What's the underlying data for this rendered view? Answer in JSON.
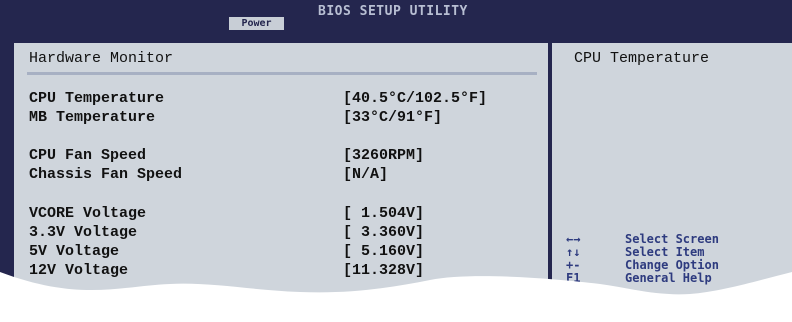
{
  "header": {
    "title": "BIOS SETUP UTILITY",
    "active_tab": "Power"
  },
  "panel": {
    "title": "Hardware Monitor",
    "rows": [
      {
        "label": "CPU Temperature",
        "value": "[40.5°C/102.5°F]"
      },
      {
        "label": "MB Temperature",
        "value": "[33°C/91°F]"
      },
      {
        "label": "CPU Fan Speed",
        "value": "[3260RPM]"
      },
      {
        "label": "Chassis Fan Speed",
        "value": "[N/A]"
      },
      {
        "label": "VCORE Voltage",
        "value": "[ 1.504V]"
      },
      {
        "label": "3.3V Voltage",
        "value": "[ 3.360V]"
      },
      {
        "label": "5V Voltage",
        "value": "[ 5.160V]"
      },
      {
        "label": "12V Voltage",
        "value": "[11.328V]"
      }
    ]
  },
  "help": {
    "title": "CPU Temperature",
    "keys": [
      {
        "key": "←→",
        "desc": "Select Screen"
      },
      {
        "key": "↑↓",
        "desc": "Select Item"
      },
      {
        "key": "+-",
        "desc": "Change Option"
      },
      {
        "key": "F1",
        "desc": "General Help"
      }
    ]
  },
  "colors": {
    "frame": "#24264e",
    "panel_bg": "#cfd5dc",
    "help_text": "#2e3b7f"
  }
}
